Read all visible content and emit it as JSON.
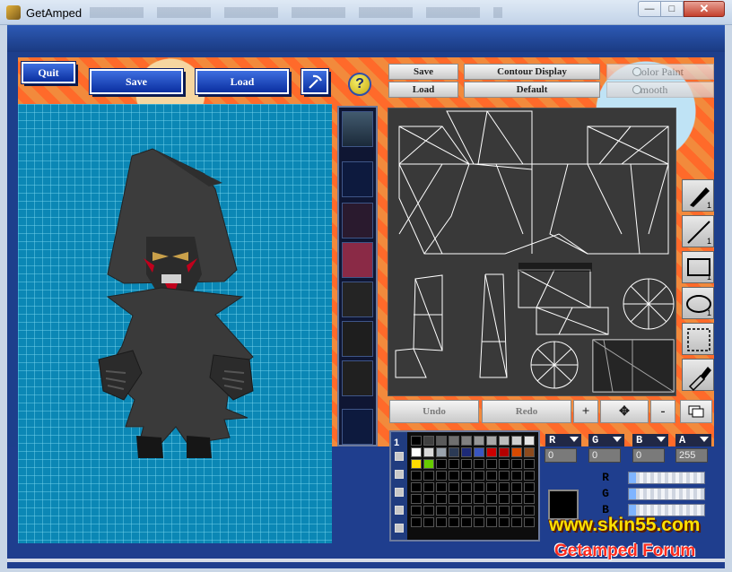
{
  "window": {
    "title": "GetAmped"
  },
  "toolbar": {
    "quit_label": "Quit",
    "save_label": "Save",
    "load_label": "Load",
    "help_label": "?"
  },
  "texture": {
    "save_label": "Save",
    "load_label": "Load",
    "contour_label": "Contour Display",
    "default_label": "Default",
    "color_paint_label": "Color Paint",
    "smooth_label": "Smooth"
  },
  "tools": [
    {
      "name": "pen",
      "level": "1"
    },
    {
      "name": "line",
      "level": "1"
    },
    {
      "name": "rectangle",
      "level": "1"
    },
    {
      "name": "ellipse",
      "level": "1"
    },
    {
      "name": "select",
      "level": ""
    },
    {
      "name": "eyedropper",
      "level": ""
    }
  ],
  "history": {
    "undo_label": "Undo",
    "redo_label": "Redo",
    "zoom_in": "+",
    "move": "✥",
    "zoom_out": "-"
  },
  "palette": {
    "tab": "1",
    "colors": [
      "#000000",
      "#404040",
      "#5a5a5a",
      "#6f6f6f",
      "#808080",
      "#969696",
      "#a8a8a8",
      "#bcbcbc",
      "#cfcfcf",
      "#e4e4e4",
      "#ffffff",
      "#d9d9d9",
      "#9aa3ad",
      "#2b3a55",
      "#1d2a78",
      "#3a56c0",
      "#cc0000",
      "#b30000",
      "#d84a00",
      "#8c4a1d",
      "#ffdd00",
      "#66cc00"
    ]
  },
  "color": {
    "r_label": "R",
    "g_label": "G",
    "b_label": "B",
    "a_label": "A",
    "r_value": "0",
    "g_value": "0",
    "b_value": "0",
    "a_value": "255",
    "current": "#000000"
  },
  "watermark": {
    "url": "www.skin55.com",
    "forum": "Getamped Forum"
  }
}
